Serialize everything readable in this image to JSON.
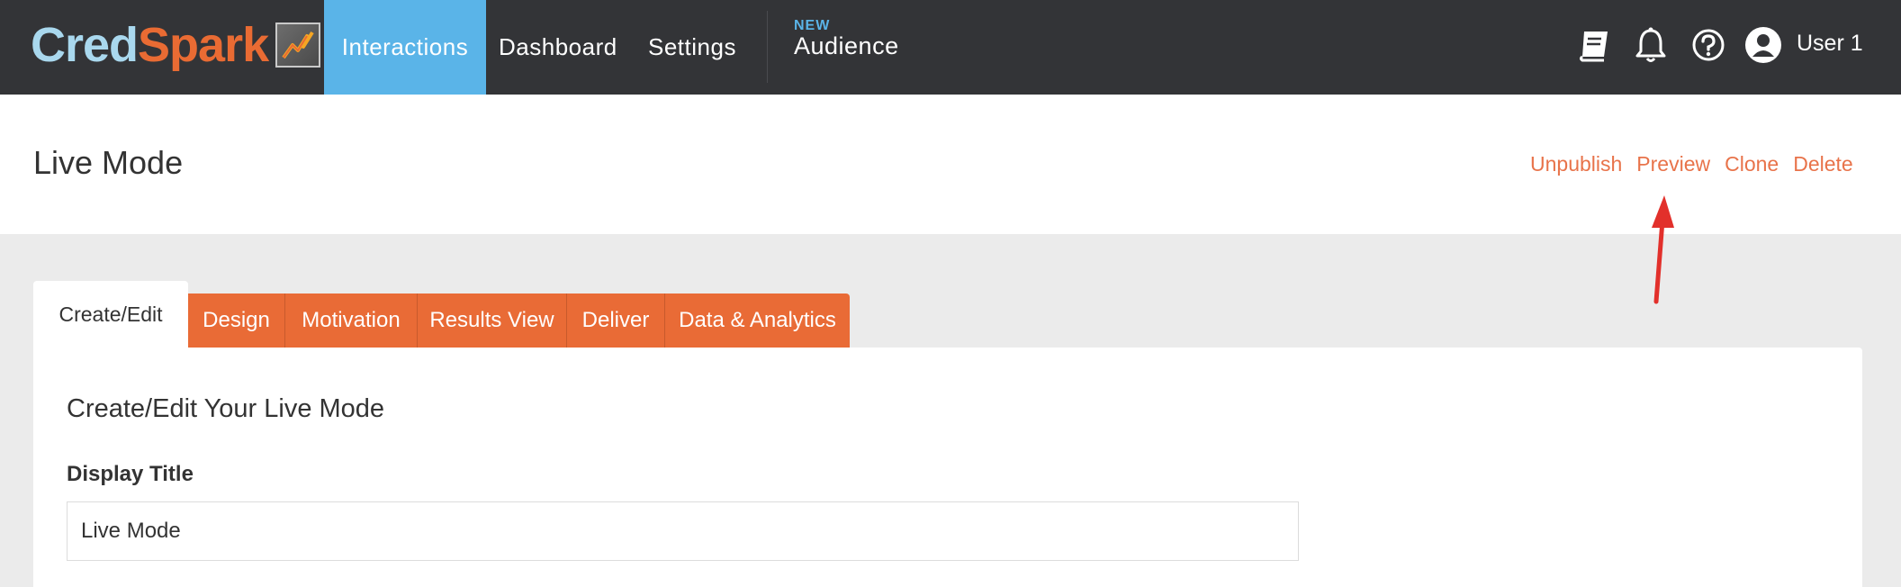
{
  "app": {
    "logo_part1": "Cred",
    "logo_part2": "Spark",
    "logo_icon": "lightning-icon"
  },
  "nav": {
    "items": [
      {
        "label": "Interactions",
        "active": true
      },
      {
        "label": "Dashboard",
        "active": false
      },
      {
        "label": "Settings",
        "active": false
      }
    ],
    "audience_badge": "NEW",
    "audience_label": "Audience"
  },
  "top_icons": [
    "book-icon",
    "bell-icon",
    "help-icon",
    "user-avatar-icon"
  ],
  "user": {
    "name": "User 1"
  },
  "page": {
    "title": "Live Mode",
    "actions": [
      "Unpublish",
      "Preview",
      "Clone",
      "Delete"
    ]
  },
  "tabs": [
    "Create/Edit",
    "Design",
    "Motivation",
    "Results View",
    "Deliver",
    "Data & Analytics"
  ],
  "form": {
    "section_title": "Create/Edit Your Live Mode",
    "display_title_label": "Display Title",
    "display_title_value": "Live Mode"
  },
  "colors": {
    "topbar": "#333437",
    "nav_active": "#5ab4e8",
    "accent_orange": "#e96b36",
    "action_link": "#e8734a",
    "annotation_arrow": "#e2302b"
  }
}
